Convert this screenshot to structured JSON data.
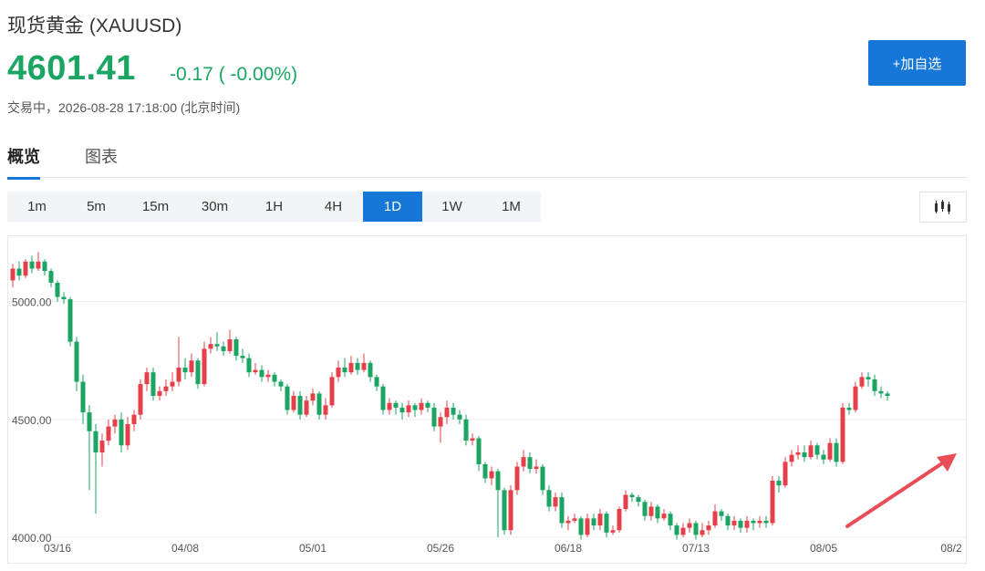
{
  "header": {
    "title": "现货黄金 (XAUUSD)",
    "price": "4601.41",
    "change": "-0.17 ( -0.00%)",
    "status": "交易中，2026-08-28 17:18:00 (北京时间)",
    "add_label": "+加自选"
  },
  "tabs": [
    {
      "label": "概览",
      "active": true
    },
    {
      "label": "图表",
      "active": false
    }
  ],
  "periods": [
    {
      "label": "1m",
      "active": false
    },
    {
      "label": "5m",
      "active": false
    },
    {
      "label": "15m",
      "active": false
    },
    {
      "label": "30m",
      "active": false
    },
    {
      "label": "1H",
      "active": false
    },
    {
      "label": "4H",
      "active": false
    },
    {
      "label": "1D",
      "active": true
    },
    {
      "label": "1W",
      "active": false
    },
    {
      "label": "1M",
      "active": false
    }
  ],
  "colors": {
    "accent": "#1677d9",
    "up": "#e5404a",
    "down": "#1aa563",
    "arrow": "#e94b57"
  },
  "icons": {
    "candle_toggle": "candlestick-icon"
  },
  "chart_data": {
    "type": "candlestick",
    "ylim": [
      4000,
      5200
    ],
    "y_ticks": [
      "5000.00",
      "4500.00",
      "4000.00"
    ],
    "y_tick_values": [
      5000,
      4500,
      4000
    ],
    "x_ticks": [
      "03/16",
      "04/08",
      "05/01",
      "05/26",
      "06/18",
      "07/13",
      "08/05",
      "08/2"
    ],
    "x_tick_index": [
      7,
      27,
      47,
      67,
      87,
      107,
      127,
      147
    ],
    "grid": true,
    "annotation": "arrow-up-right",
    "candles": [
      [
        5090,
        5140,
        5160,
        5060
      ],
      [
        5140,
        5110,
        5170,
        5090
      ],
      [
        5110,
        5170,
        5180,
        5100
      ],
      [
        5170,
        5140,
        5195,
        5120
      ],
      [
        5140,
        5170,
        5210,
        5130
      ],
      [
        5170,
        5130,
        5180,
        5110
      ],
      [
        5130,
        5080,
        5140,
        5060
      ],
      [
        5080,
        5020,
        5090,
        5000
      ],
      [
        5020,
        5010,
        5040,
        4990
      ],
      [
        5010,
        4830,
        5020,
        4810
      ],
      [
        4830,
        4660,
        4850,
        4620
      ],
      [
        4660,
        4530,
        4690,
        4480
      ],
      [
        4530,
        4450,
        4560,
        4200
      ],
      [
        4450,
        4360,
        4480,
        4100
      ],
      [
        4360,
        4410,
        4440,
        4300
      ],
      [
        4410,
        4470,
        4500,
        4390
      ],
      [
        4470,
        4500,
        4520,
        4440
      ],
      [
        4500,
        4390,
        4530,
        4360
      ],
      [
        4390,
        4480,
        4510,
        4370
      ],
      [
        4480,
        4520,
        4540,
        4450
      ],
      [
        4520,
        4650,
        4670,
        4500
      ],
      [
        4650,
        4700,
        4720,
        4620
      ],
      [
        4700,
        4600,
        4720,
        4580
      ],
      [
        4600,
        4620,
        4640,
        4580
      ],
      [
        4620,
        4640,
        4670,
        4600
      ],
      [
        4640,
        4660,
        4700,
        4620
      ],
      [
        4660,
        4720,
        4850,
        4640
      ],
      [
        4720,
        4700,
        4760,
        4670
      ],
      [
        4700,
        4750,
        4780,
        4680
      ],
      [
        4750,
        4650,
        4760,
        4630
      ],
      [
        4650,
        4800,
        4830,
        4640
      ],
      [
        4800,
        4820,
        4850,
        4780
      ],
      [
        4820,
        4810,
        4870,
        4790
      ],
      [
        4810,
        4790,
        4830,
        4770
      ],
      [
        4790,
        4840,
        4880,
        4780
      ],
      [
        4840,
        4770,
        4850,
        4750
      ],
      [
        4770,
        4760,
        4800,
        4740
      ],
      [
        4760,
        4700,
        4780,
        4680
      ],
      [
        4700,
        4710,
        4740,
        4690
      ],
      [
        4710,
        4680,
        4730,
        4660
      ],
      [
        4680,
        4690,
        4710,
        4660
      ],
      [
        4690,
        4660,
        4700,
        4640
      ],
      [
        4660,
        4640,
        4670,
        4620
      ],
      [
        4640,
        4540,
        4650,
        4520
      ],
      [
        4540,
        4600,
        4620,
        4530
      ],
      [
        4600,
        4520,
        4620,
        4500
      ],
      [
        4520,
        4580,
        4600,
        4510
      ],
      [
        4580,
        4610,
        4630,
        4560
      ],
      [
        4610,
        4520,
        4620,
        4500
      ],
      [
        4520,
        4560,
        4590,
        4500
      ],
      [
        4560,
        4680,
        4700,
        4550
      ],
      [
        4680,
        4720,
        4750,
        4660
      ],
      [
        4720,
        4700,
        4760,
        4680
      ],
      [
        4700,
        4740,
        4770,
        4690
      ],
      [
        4740,
        4710,
        4760,
        4690
      ],
      [
        4710,
        4740,
        4780,
        4700
      ],
      [
        4740,
        4680,
        4750,
        4660
      ],
      [
        4680,
        4640,
        4690,
        4620
      ],
      [
        4640,
        4540,
        4650,
        4520
      ],
      [
        4540,
        4570,
        4590,
        4520
      ],
      [
        4570,
        4550,
        4580,
        4520
      ],
      [
        4550,
        4530,
        4570,
        4500
      ],
      [
        4530,
        4560,
        4580,
        4510
      ],
      [
        4560,
        4540,
        4570,
        4510
      ],
      [
        4540,
        4570,
        4590,
        4520
      ],
      [
        4570,
        4550,
        4580,
        4530
      ],
      [
        4550,
        4470,
        4570,
        4450
      ],
      [
        4470,
        4510,
        4530,
        4400
      ],
      [
        4510,
        4550,
        4580,
        4480
      ],
      [
        4550,
        4520,
        4570,
        4500
      ],
      [
        4520,
        4500,
        4540,
        4480
      ],
      [
        4500,
        4410,
        4520,
        4390
      ],
      [
        4410,
        4420,
        4440,
        4390
      ],
      [
        4420,
        4310,
        4430,
        4280
      ],
      [
        4310,
        4250,
        4320,
        4230
      ],
      [
        4250,
        4280,
        4300,
        4220
      ],
      [
        4280,
        4200,
        4290,
        4000
      ],
      [
        4200,
        4030,
        4210,
        4010
      ],
      [
        4030,
        4200,
        4220,
        4010
      ],
      [
        4200,
        4300,
        4320,
        4180
      ],
      [
        4300,
        4340,
        4370,
        4280
      ],
      [
        4340,
        4290,
        4360,
        4270
      ],
      [
        4290,
        4300,
        4330,
        4270
      ],
      [
        4300,
        4200,
        4310,
        4180
      ],
      [
        4200,
        4130,
        4220,
        4110
      ],
      [
        4130,
        4170,
        4190,
        4110
      ],
      [
        4170,
        4060,
        4190,
        4040
      ],
      [
        4060,
        4070,
        4090,
        4030
      ],
      [
        4070,
        4080,
        4100,
        4060
      ],
      [
        4080,
        4010,
        4090,
        3990
      ],
      [
        4010,
        4080,
        4100,
        4000
      ],
      [
        4080,
        4050,
        4100,
        4030
      ],
      [
        4050,
        4100,
        4120,
        4030
      ],
      [
        4100,
        4020,
        4110,
        4000
      ],
      [
        4020,
        4030,
        4050,
        4010
      ],
      [
        4030,
        4120,
        4130,
        4020
      ],
      [
        4120,
        4180,
        4200,
        4110
      ],
      [
        4180,
        4170,
        4190,
        4150
      ],
      [
        4170,
        4150,
        4180,
        4130
      ],
      [
        4150,
        4090,
        4160,
        4070
      ],
      [
        4090,
        4130,
        4150,
        4070
      ],
      [
        4130,
        4080,
        4140,
        4060
      ],
      [
        4080,
        4100,
        4120,
        4070
      ],
      [
        4100,
        4050,
        4110,
        4030
      ],
      [
        4050,
        4010,
        4060,
        3990
      ],
      [
        4010,
        4040,
        4060,
        4000
      ],
      [
        4040,
        4060,
        4080,
        4020
      ],
      [
        4060,
        4010,
        4070,
        3990
      ],
      [
        4010,
        4030,
        4060,
        4000
      ],
      [
        4030,
        4050,
        4070,
        4010
      ],
      [
        4050,
        4110,
        4140,
        4040
      ],
      [
        4110,
        4090,
        4120,
        4070
      ],
      [
        4090,
        4050,
        4100,
        4030
      ],
      [
        4050,
        4070,
        4090,
        4030
      ],
      [
        4070,
        4040,
        4080,
        4020
      ],
      [
        4040,
        4070,
        4090,
        4020
      ],
      [
        4070,
        4060,
        4080,
        4030
      ],
      [
        4060,
        4070,
        4090,
        4040
      ],
      [
        4070,
        4060,
        4090,
        4040
      ],
      [
        4060,
        4240,
        4260,
        4050
      ],
      [
        4240,
        4220,
        4260,
        4190
      ],
      [
        4220,
        4320,
        4340,
        4210
      ],
      [
        4320,
        4350,
        4370,
        4300
      ],
      [
        4350,
        4360,
        4390,
        4330
      ],
      [
        4360,
        4340,
        4390,
        4320
      ],
      [
        4340,
        4390,
        4410,
        4330
      ],
      [
        4390,
        4350,
        4400,
        4330
      ],
      [
        4350,
        4330,
        4370,
        4310
      ],
      [
        4330,
        4400,
        4420,
        4320
      ],
      [
        4400,
        4320,
        4420,
        4300
      ],
      [
        4320,
        4550,
        4570,
        4310
      ],
      [
        4550,
        4540,
        4570,
        4520
      ],
      [
        4540,
        4640,
        4660,
        4530
      ],
      [
        4640,
        4680,
        4700,
        4630
      ],
      [
        4680,
        4670,
        4700,
        4640
      ],
      [
        4670,
        4620,
        4690,
        4600
      ],
      [
        4620,
        4610,
        4640,
        4590
      ],
      [
        4610,
        4600,
        4620,
        4580
      ]
    ]
  }
}
